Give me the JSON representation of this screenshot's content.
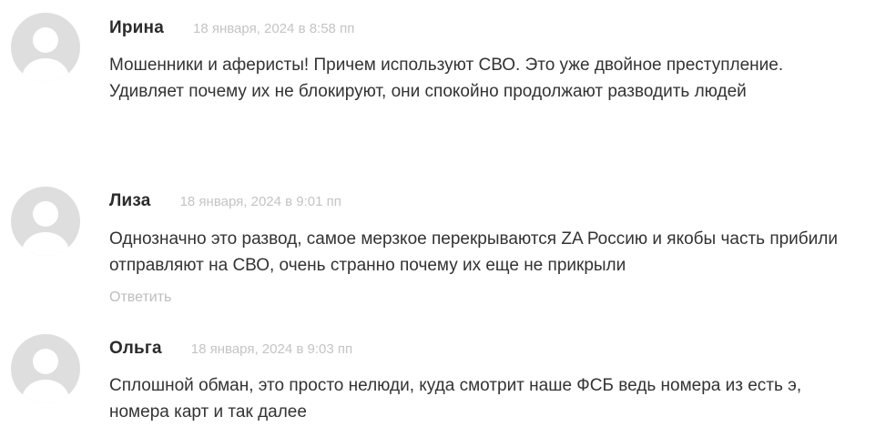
{
  "comments": [
    {
      "author": "Ирина",
      "date": "18 января, 2024 в 8:58 пп",
      "text": "Мошенники и аферисты! Причем используют СВО. Это уже двойное преступление. Удивляет почему их не блокируют, они спокойно продолжают разводить людей"
    },
    {
      "author": "Лиза",
      "date": "18 января, 2024 в 9:01 пп",
      "text": "Однозначно это развод, самое мерзкое перекрываются ZA Россию и якобы часть прибили отправляют на СВО, очень странно почему их еще не прикрыли",
      "reply": "Ответить"
    },
    {
      "author": "Ольга",
      "date": "18 января, 2024 в 9:03 пп",
      "text": "Сплошной обман, это просто нелюди, куда смотрит наше ФСБ ведь номера из есть э, номера карт и так далее"
    }
  ],
  "colors": {
    "avatar_bg": "#dedede",
    "avatar_figure": "#ffffff",
    "author": "#2b2b2b",
    "date": "#c4c4c4",
    "text": "#333333",
    "reply": "#bdbdbd"
  },
  "icons": {
    "avatar": "default-user-avatar-icon"
  }
}
